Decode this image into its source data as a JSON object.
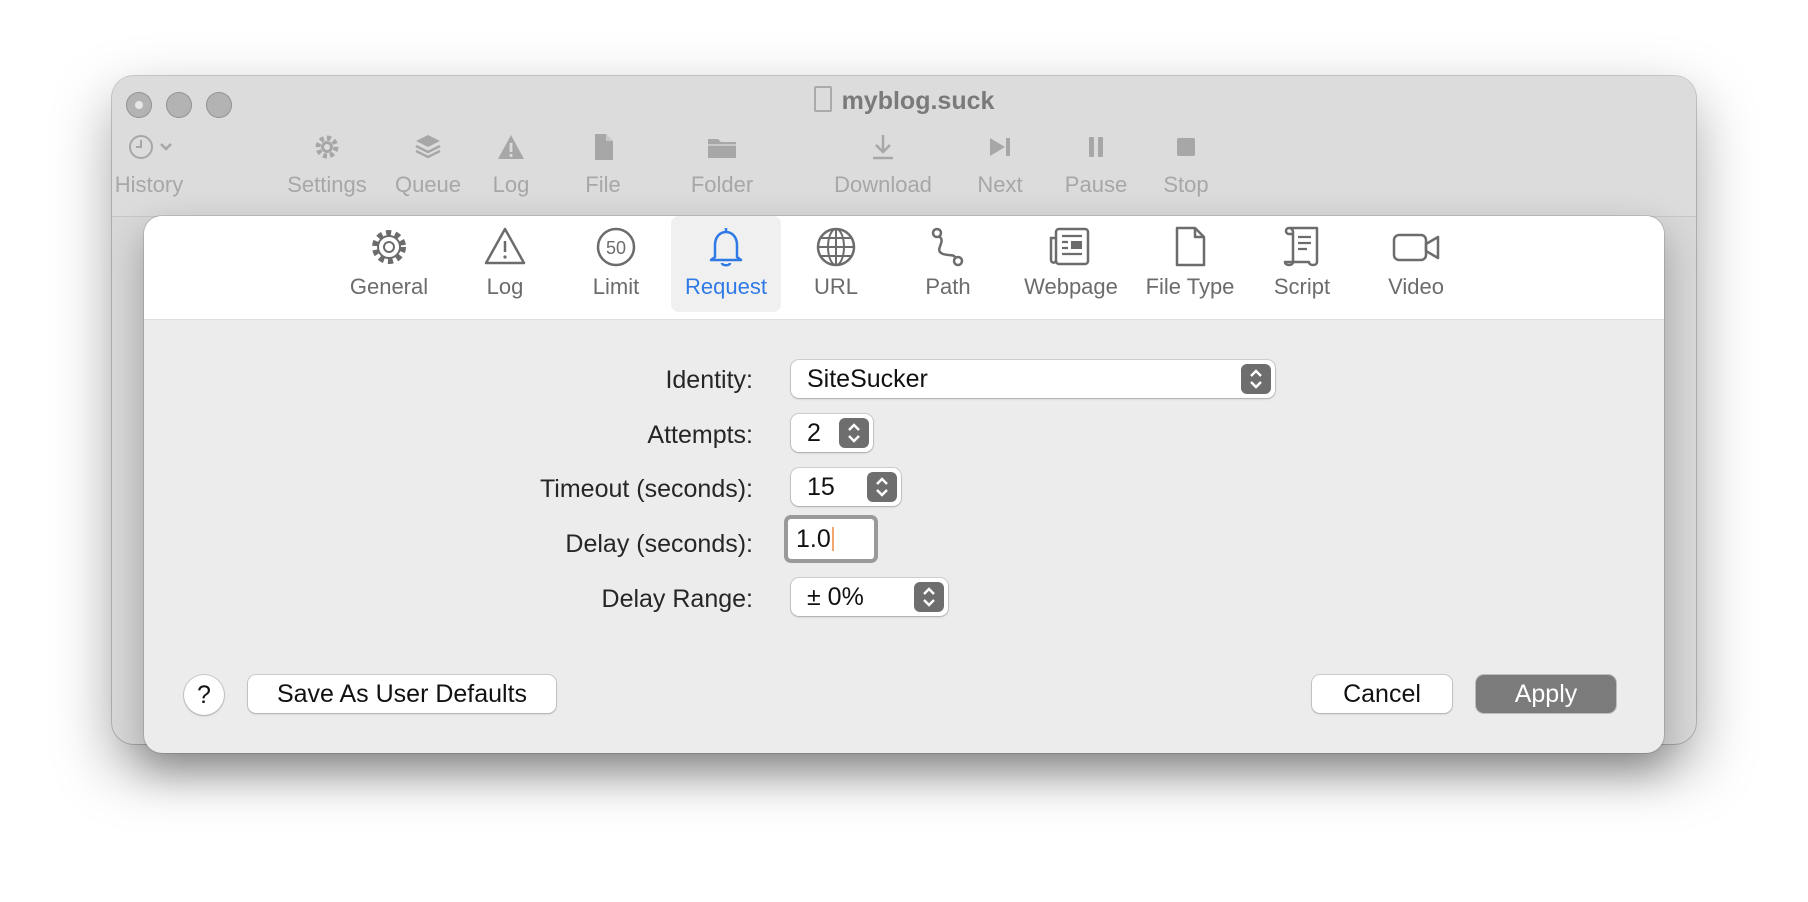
{
  "window": {
    "title": "myblog.suck"
  },
  "toolbar": {
    "history": "History",
    "settings": "Settings",
    "queue": "Queue",
    "log": "Log",
    "file": "File",
    "folder": "Folder",
    "download": "Download",
    "next": "Next",
    "pause": "Pause",
    "stop": "Stop"
  },
  "tabs": [
    {
      "label": "General",
      "icon": "gear-icon"
    },
    {
      "label": "Log",
      "icon": "warning-triangle-icon"
    },
    {
      "label": "Limit",
      "icon": "speed-limit-icon",
      "icon_text": "50"
    },
    {
      "label": "Request",
      "icon": "bell-icon"
    },
    {
      "label": "URL",
      "icon": "globe-icon"
    },
    {
      "label": "Path",
      "icon": "path-icon"
    },
    {
      "label": "Webpage",
      "icon": "newspaper-icon"
    },
    {
      "label": "File Type",
      "icon": "document-icon"
    },
    {
      "label": "Script",
      "icon": "scroll-icon"
    },
    {
      "label": "Video",
      "icon": "video-camera-icon"
    }
  ],
  "active_tab": "Request",
  "form": {
    "identity": {
      "label": "Identity:",
      "value": "SiteSucker"
    },
    "attempts": {
      "label": "Attempts:",
      "value": "2"
    },
    "timeout": {
      "label": "Timeout (seconds):",
      "value": "15"
    },
    "delay": {
      "label": "Delay (seconds):",
      "value": "1.0"
    },
    "delay_range": {
      "label": "Delay Range:",
      "value": "± 0%"
    }
  },
  "buttons": {
    "help": "?",
    "save_defaults": "Save As User Defaults",
    "cancel": "Cancel",
    "apply": "Apply"
  },
  "colors": {
    "accent": "#2f7ae5",
    "apply_button": "#7b7b7b",
    "sheet_bg": "#ececec"
  }
}
